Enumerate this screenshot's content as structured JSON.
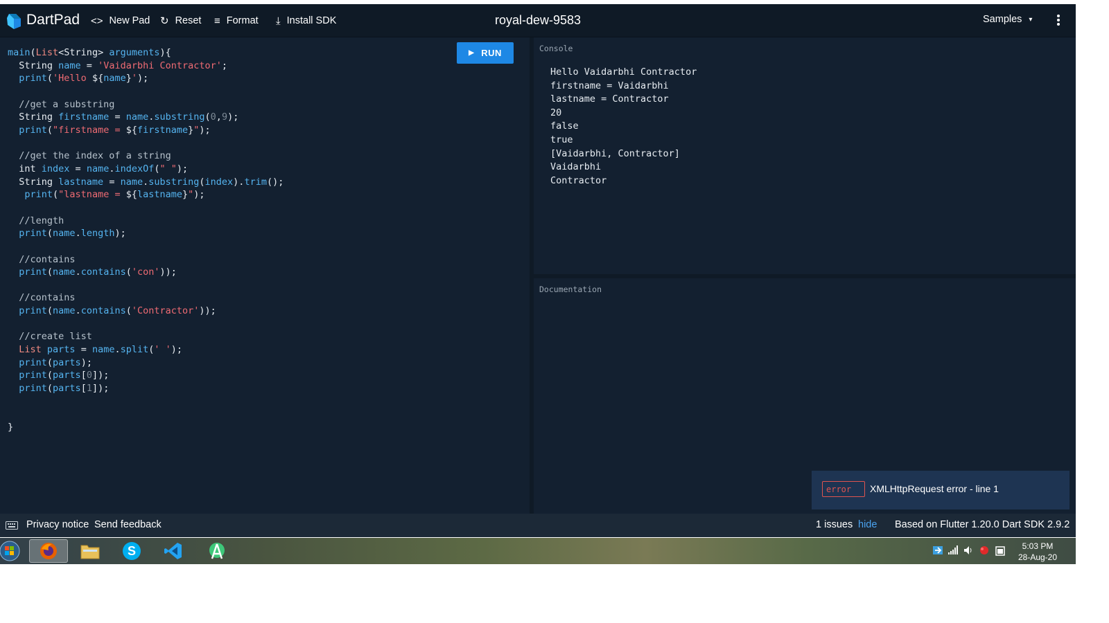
{
  "app": {
    "brand": "DartPad",
    "pad_name": "royal-dew-9583"
  },
  "toolbar": {
    "new_pad": "New Pad",
    "reset": "Reset",
    "format": "Format",
    "install_sdk": "Install SDK",
    "samples": "Samples"
  },
  "editor": {
    "run_label": "RUN"
  },
  "console": {
    "label": "Console",
    "lines": [
      "Hello Vaidarbhi Contractor",
      "firstname = Vaidarbhi",
      "lastname = Contractor",
      "20",
      "false",
      "true",
      "[Vaidarbhi, Contractor]",
      "Vaidarbhi",
      "Contractor"
    ]
  },
  "documentation": {
    "label": "Documentation"
  },
  "issue_popup": {
    "badge": "error",
    "message": "XMLHttpRequest error - line 1"
  },
  "footer": {
    "privacy": "Privacy notice",
    "feedback": "Send feedback",
    "issues": "1 issues",
    "hide": "hide",
    "version": "Based on Flutter 1.20.0 Dart SDK 2.9.2"
  },
  "taskbar": {
    "time": "5:03 PM",
    "date": "28-Aug-20"
  },
  "colors": {
    "background": "#132030",
    "run_button": "#1e88e5",
    "error": "#e0544f",
    "link": "#4aa3f0"
  }
}
